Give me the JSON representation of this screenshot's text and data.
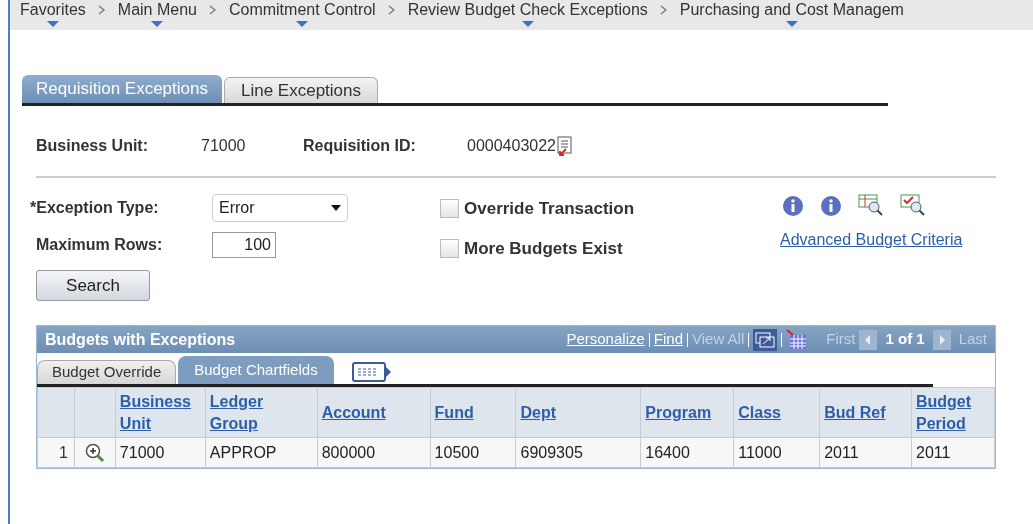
{
  "breadcrumb": [
    {
      "label": "Favorites"
    },
    {
      "label": "Main Menu"
    },
    {
      "label": "Commitment Control"
    },
    {
      "label": "Review Budget Check Exceptions"
    },
    {
      "label": "Purchasing and Cost Managem"
    }
  ],
  "tabs": [
    {
      "label": "Requisition Exceptions",
      "selected": true
    },
    {
      "label": "Line Exceptions",
      "selected": false
    }
  ],
  "header": {
    "business_unit_label": "Business Unit:",
    "business_unit": "71000",
    "requisition_label": "Requisition ID:",
    "requisition_id": "0000403022"
  },
  "exception_type": {
    "label": "*Exception Type:",
    "value": "Error"
  },
  "maximum_rows": {
    "label": "Maximum Rows:",
    "value": "100"
  },
  "checkboxes": [
    {
      "label": "Override Transaction",
      "checked": false
    },
    {
      "label": "More Budgets Exist",
      "checked": false
    }
  ],
  "advanced_link": "Advanced Budget Criteria",
  "search_button": "Search",
  "grid": {
    "title": "Budgets with Exceptions",
    "nav": {
      "personalize": "Personalize",
      "find": "Find",
      "view_all": "View All",
      "first": "First",
      "count": "1 of 1",
      "last": "Last"
    },
    "tabs": [
      {
        "label": "Budget Override",
        "selected": false
      },
      {
        "label": "Budget Chartfields",
        "selected": true
      }
    ],
    "columns": [
      "Business Unit",
      "Ledger Group",
      "Account",
      "Fund",
      "Dept",
      "Program",
      "Class",
      "Bud Ref",
      "Budget Period"
    ],
    "rows": [
      {
        "number": "1",
        "cells": [
          "71000",
          "APPROP",
          "800000",
          "10500",
          "6909305",
          "16400",
          "11000",
          "2011",
          "2011"
        ]
      }
    ]
  }
}
